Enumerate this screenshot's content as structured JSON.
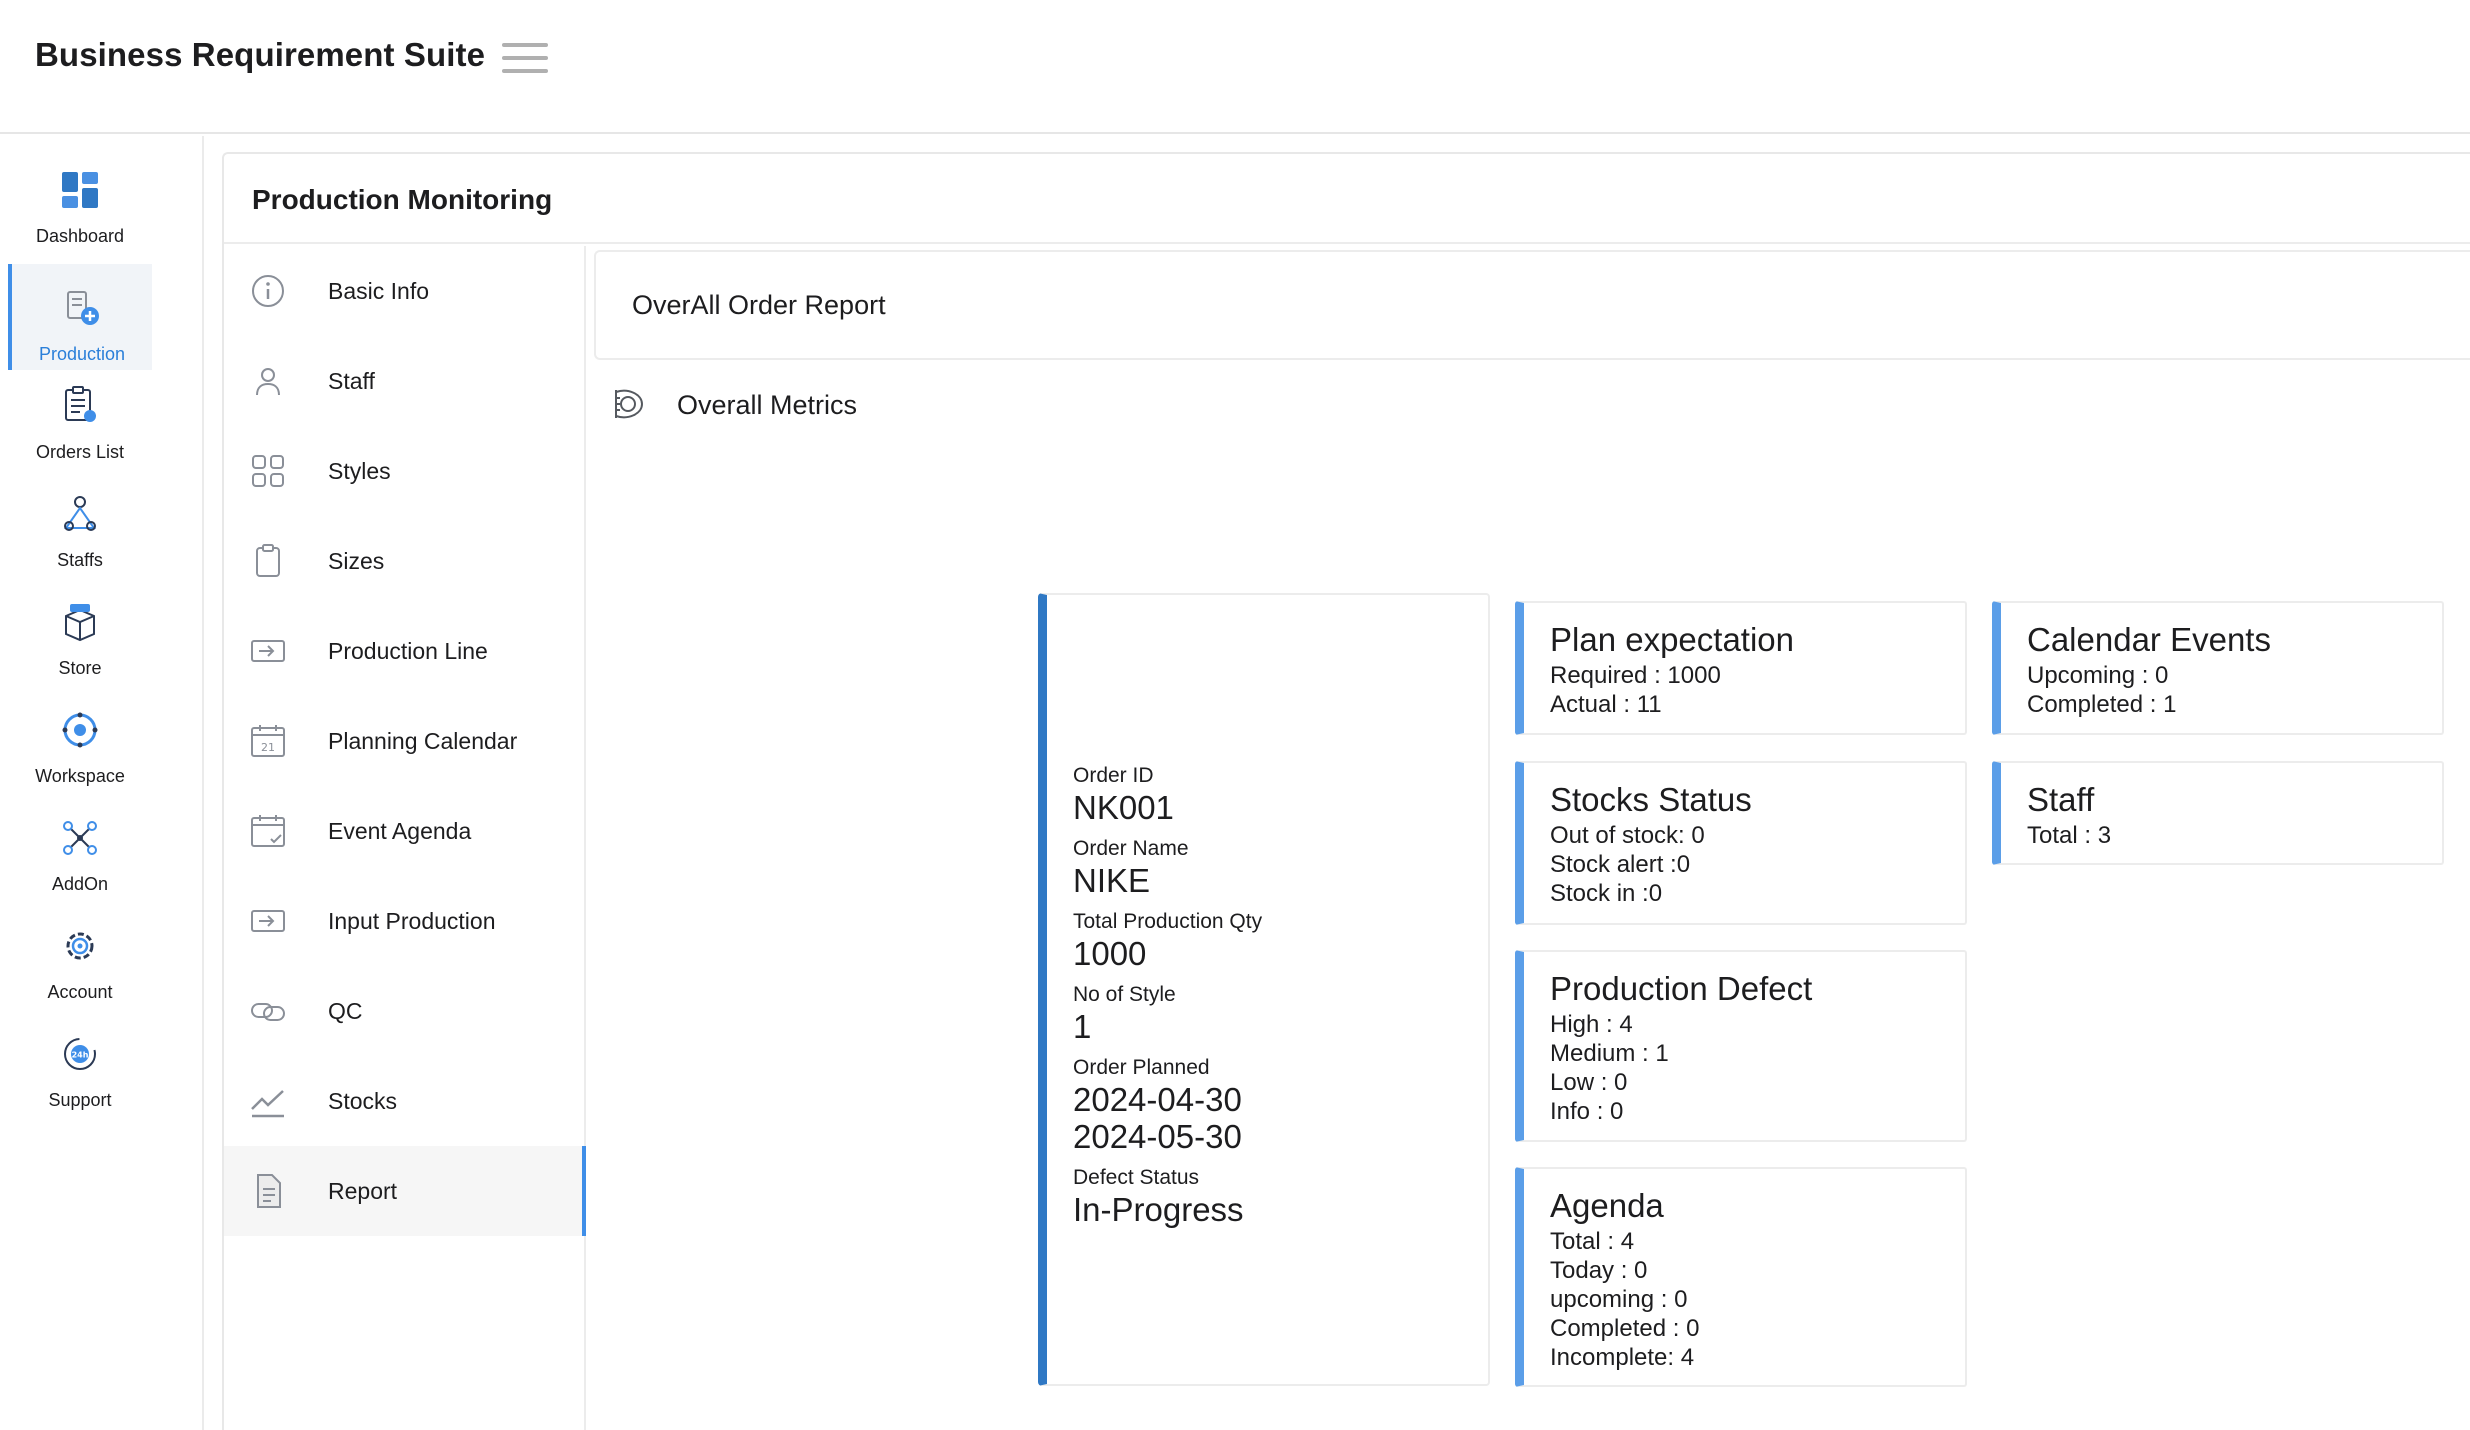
{
  "app": {
    "title": "Business Requirement Suite"
  },
  "rail": {
    "items": [
      {
        "label": "Dashboard",
        "icon": "dashboard-icon"
      },
      {
        "label": "Production",
        "icon": "production-icon",
        "active": true
      },
      {
        "label": "Orders List",
        "icon": "orders-list-icon"
      },
      {
        "label": "Staffs",
        "icon": "staffs-icon"
      },
      {
        "label": "Store",
        "icon": "store-icon"
      },
      {
        "label": "Workspace",
        "icon": "workspace-icon"
      },
      {
        "label": "AddOn",
        "icon": "addon-icon"
      },
      {
        "label": "Account",
        "icon": "account-gear-icon"
      },
      {
        "label": "Support",
        "icon": "support-24h-icon"
      }
    ]
  },
  "main": {
    "title": "Production Monitoring"
  },
  "subnav": {
    "items": [
      {
        "label": "Basic Info",
        "icon": "info-icon"
      },
      {
        "label": "Staff",
        "icon": "person-icon"
      },
      {
        "label": "Styles",
        "icon": "grid-icon"
      },
      {
        "label": "Sizes",
        "icon": "clipboard-icon"
      },
      {
        "label": "Production Line",
        "icon": "arrow-in-box-icon"
      },
      {
        "label": "Planning Calendar",
        "icon": "calendar-21-icon"
      },
      {
        "label": "Event Agenda",
        "icon": "calendar-check-icon"
      },
      {
        "label": "Input Production",
        "icon": "arrow-in-box-icon"
      },
      {
        "label": "QC",
        "icon": "link-icon"
      },
      {
        "label": "Stocks",
        "icon": "line-chart-icon"
      },
      {
        "label": "Report",
        "icon": "document-icon",
        "active": true
      }
    ]
  },
  "report": {
    "title": "OverAll Order Report",
    "metrics_label": "Overall Metrics"
  },
  "order": {
    "order_id_label": "Order ID",
    "order_id": "NK001",
    "order_name_label": "Order Name",
    "order_name": "NIKE",
    "total_qty_label": "Total Production Qty",
    "total_qty": "1000",
    "styles_label": "No of Style",
    "styles": "1",
    "planned_label": "Order Planned",
    "planned_start": "2024-04-30",
    "planned_end": "2024-05-30",
    "defect_label": "Defect Status",
    "defect_status": "In-Progress"
  },
  "cards": {
    "plan": {
      "title": "Plan expectation",
      "lines": [
        "Required : 1000",
        "Actual : 11"
      ]
    },
    "stocks": {
      "title": "Stocks Status",
      "lines": [
        "Out of stock: 0",
        "Stock alert :0",
        "Stock in :0"
      ]
    },
    "defect": {
      "title": "Production Defect",
      "lines": [
        "High : 4",
        "Medium : 1",
        "Low : 0",
        "Info : 0"
      ]
    },
    "agenda": {
      "title": "Agenda",
      "lines": [
        "Total : 4",
        "Today : 0",
        "upcoming : 0",
        "Completed : 0",
        "Incomplete: 4"
      ]
    },
    "calendar": {
      "title": "Calendar Events",
      "lines": [
        "Upcoming : 0",
        "Completed : 1"
      ]
    },
    "staff": {
      "title": "Staff",
      "lines": [
        "Total : 3"
      ]
    }
  },
  "colors": {
    "accent": "#3f8ee8",
    "order_card_border": "#2f78c4",
    "metric_card_border": "#5b9ee8"
  }
}
